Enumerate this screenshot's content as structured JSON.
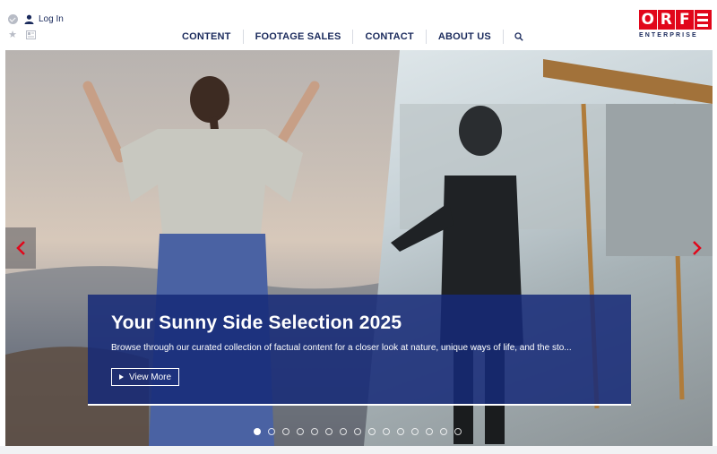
{
  "header": {
    "login_label": "Log In",
    "icons": [
      "verified-icon",
      "user-icon",
      "star-icon",
      "card-icon",
      "search-icon"
    ]
  },
  "nav": {
    "items": [
      "CONTENT",
      "FOOTAGE SALES",
      "CONTACT",
      "ABOUT US"
    ]
  },
  "logo": {
    "letters": [
      "O",
      "R",
      "F"
    ],
    "subtitle": "ENTERPRISE",
    "brand_color": "#e1061a"
  },
  "hero": {
    "title": "Your Sunny Side Selection 2025",
    "text": "Browse through our curated collection of factual content for a closer look at nature, unique ways of life, and the sto...",
    "button_label": "View More",
    "slide_count": 15,
    "active_slide": 1,
    "overlay_color": "#162a78",
    "arrow_color": "#e1061a"
  }
}
